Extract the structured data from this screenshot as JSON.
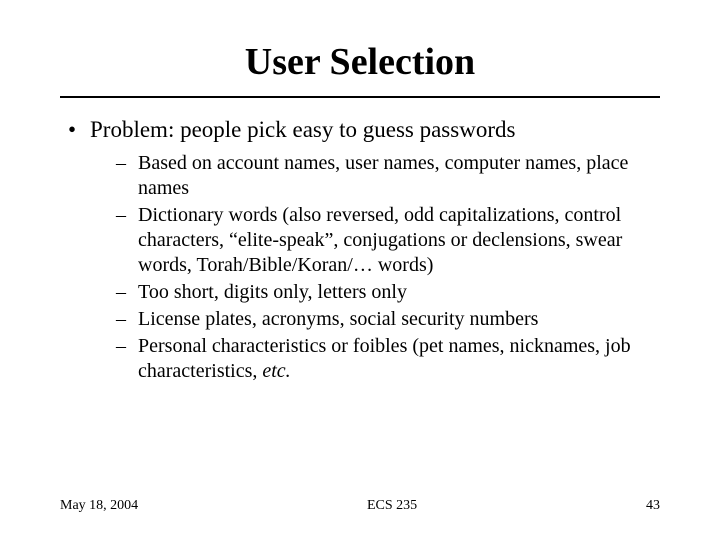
{
  "title": "User Selection",
  "level1": [
    {
      "text": "Problem: people pick easy to guess passwords"
    }
  ],
  "level2": [
    {
      "text": "Based on account names, user names, computer names, place names"
    },
    {
      "text": "Dictionary words (also reversed, odd capitalizations, control characters, “elite-speak”, conjugations or declensions, swear words, Torah/Bible/Koran/… words)"
    },
    {
      "text": "Too short, digits only, letters only"
    },
    {
      "text": "License plates, acronyms, social security numbers"
    },
    {
      "prefix": "Personal characteristics or foibles (pet names, nicknames, job characteristics, ",
      "italic": "etc.",
      "suffix": ""
    }
  ],
  "footer": {
    "date": "May 18, 2004",
    "course": "ECS 235",
    "page": "43"
  }
}
